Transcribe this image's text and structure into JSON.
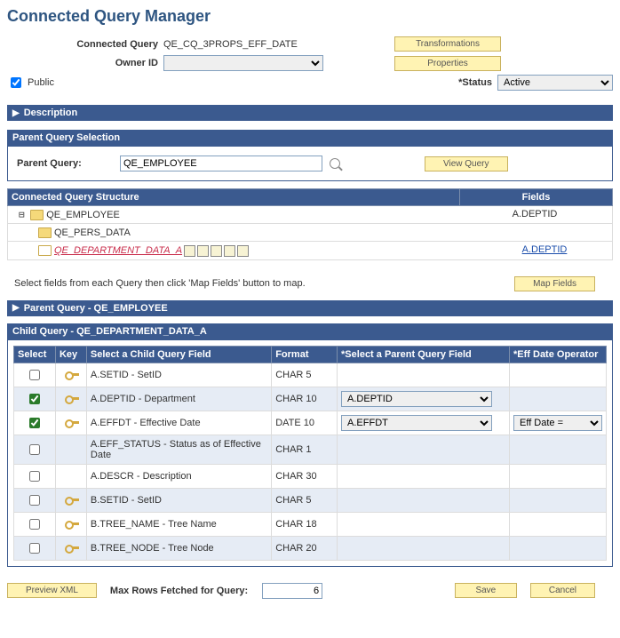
{
  "pageTitle": "Connected Query Manager",
  "labels": {
    "connectedQuery": "Connected Query",
    "ownerId": "Owner ID",
    "public": "Public",
    "status": "*Status",
    "parentQuery": "Parent Query:",
    "maxRows": "Max Rows Fetched for Query:",
    "treeFieldsHeader": "Fields",
    "treeStructureHeader": "Connected Query Structure",
    "selectHint": "Select fields from each Query then click 'Map Fields' button to map."
  },
  "connectedQuery": "QE_CQ_3PROPS_EFF_DATE",
  "status": {
    "selected": "Active"
  },
  "publicChecked": true,
  "buttons": {
    "transformations": "Transformations",
    "properties": "Properties",
    "viewQuery": "View Query",
    "mapFields": "Map Fields",
    "previewXml": "Preview XML",
    "save": "Save",
    "cancel": "Cancel"
  },
  "sections": {
    "description": "Description",
    "parentQuerySelection": "Parent Query Selection",
    "parentQuery": "Parent Query - QE_EMPLOYEE",
    "childQuery": "Child Query - QE_DEPARTMENT_DATA_A"
  },
  "parentQueryValue": "QE_EMPLOYEE",
  "tree": [
    {
      "label": "QE_EMPLOYEE",
      "indent": 0,
      "fields": "A.DEPTID",
      "link": false,
      "selected": false
    },
    {
      "label": "QE_PERS_DATA",
      "indent": 1,
      "fields": "",
      "link": false,
      "selected": false
    },
    {
      "label": "QE_DEPARTMENT_DATA_A",
      "indent": 1,
      "fields": "A.DEPTID",
      "link": true,
      "selected": true,
      "fieldsLink": true
    }
  ],
  "columns": {
    "select": "Select",
    "key": "Key",
    "childField": "Select a Child Query Field",
    "format": "Format",
    "parentField": "*Select a Parent Query Field",
    "effDate": "*Eff Date Operator"
  },
  "rows": [
    {
      "checked": false,
      "key": true,
      "field": "A.SETID - SetID",
      "format": "CHAR 5",
      "parent": "",
      "eff": ""
    },
    {
      "checked": true,
      "key": true,
      "field": "A.DEPTID - Department",
      "format": "CHAR 10",
      "parent": "A.DEPTID",
      "eff": ""
    },
    {
      "checked": true,
      "key": true,
      "field": "A.EFFDT - Effective Date",
      "format": "DATE 10",
      "parent": "A.EFFDT",
      "eff": "Eff Date ="
    },
    {
      "checked": false,
      "key": false,
      "field": "A.EFF_STATUS - Status as of Effective Date",
      "format": "CHAR 1",
      "parent": "",
      "eff": ""
    },
    {
      "checked": false,
      "key": false,
      "field": "A.DESCR - Description",
      "format": "CHAR 30",
      "parent": "",
      "eff": ""
    },
    {
      "checked": false,
      "key": true,
      "field": "B.SETID - SetID",
      "format": "CHAR 5",
      "parent": "",
      "eff": ""
    },
    {
      "checked": false,
      "key": true,
      "field": "B.TREE_NAME - Tree Name",
      "format": "CHAR 18",
      "parent": "",
      "eff": ""
    },
    {
      "checked": false,
      "key": true,
      "field": "B.TREE_NODE - Tree Node",
      "format": "CHAR 20",
      "parent": "",
      "eff": ""
    }
  ],
  "maxRows": "6"
}
